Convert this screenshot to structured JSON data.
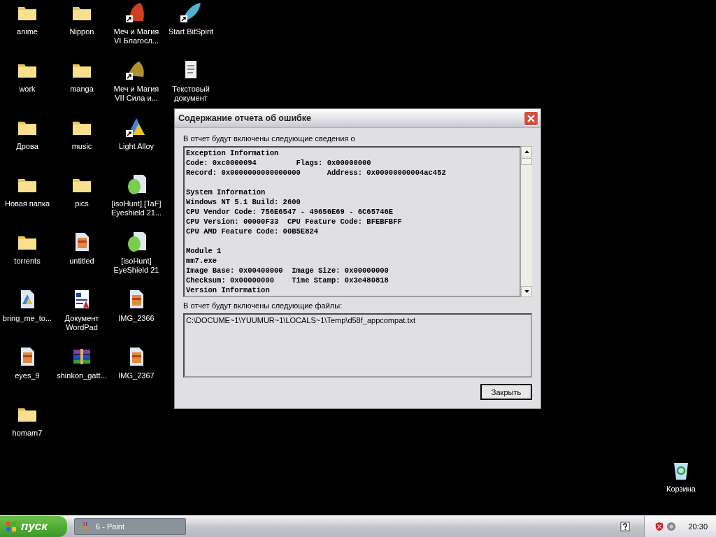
{
  "desktop_columns": [
    [
      {
        "label": "anime",
        "kind": "folder",
        "shortcut": false
      },
      {
        "label": "work",
        "kind": "folder",
        "shortcut": false
      },
      {
        "label": "Дрова",
        "kind": "folder",
        "shortcut": false
      },
      {
        "label": "Новая папка",
        "kind": "folder",
        "shortcut": false
      },
      {
        "label": "torrents",
        "kind": "folder",
        "shortcut": false
      },
      {
        "label": "bring_me_to...",
        "kind": "media",
        "shortcut": false
      },
      {
        "label": "eyes_9",
        "kind": "image",
        "shortcut": false
      },
      {
        "label": "homam7",
        "kind": "folder",
        "shortcut": false
      }
    ],
    [
      {
        "label": "Nippon",
        "kind": "folder",
        "shortcut": false
      },
      {
        "label": "manga",
        "kind": "folder",
        "shortcut": false
      },
      {
        "label": "music",
        "kind": "folder",
        "shortcut": false
      },
      {
        "label": "pics",
        "kind": "folder",
        "shortcut": false
      },
      {
        "label": "untitled",
        "kind": "image",
        "shortcut": false
      },
      {
        "label": "Документ WordPad",
        "kind": "wordpad",
        "shortcut": false
      },
      {
        "label": "shinkon_gatt...",
        "kind": "archive",
        "shortcut": false
      }
    ],
    [
      {
        "label": "Меч и Магия VI Благосл...",
        "kind": "dragon",
        "shortcut": true
      },
      {
        "label": "Меч и Магия VII Сила и...",
        "kind": "griffin",
        "shortcut": true
      },
      {
        "label": "Light Alloy",
        "kind": "player",
        "shortcut": true
      },
      {
        "label": "[isoHunt] [TaF] Eyeshield 21...",
        "kind": "torrent",
        "shortcut": false
      },
      {
        "label": "[isoHunt] EyeShield 21",
        "kind": "torrent",
        "shortcut": false
      },
      {
        "label": "IMG_2366",
        "kind": "image",
        "shortcut": false
      },
      {
        "label": "IMG_2367",
        "kind": "image",
        "shortcut": false
      }
    ],
    [
      {
        "label": "Start BitSpirit",
        "kind": "feather",
        "shortcut": true
      },
      {
        "label": "Текстовый документ",
        "kind": "text",
        "shortcut": false
      }
    ]
  ],
  "recycle_bin": {
    "label": "Корзина"
  },
  "dialog": {
    "title": "Содержание отчета об ошибке",
    "details_label": "В отчет будут включены следующие сведения о",
    "details": [
      [
        "Exception Information",
        "Code: 0xc0000094         Flags: 0x00000000",
        "Record: 0x0000000000000000      Address: 0x00000000004ac452"
      ],
      [
        "System Information",
        "Windows NT 5.1 Build: 2600",
        "CPU Vendor Code: 756E6547 - 49656E69 - 6C65746E",
        "CPU Version: 00000F33  CPU Feature Code: BFEBFBFF",
        "CPU AMD Feature Code: 00B5E824"
      ],
      [
        "Module 1",
        "mm7.exe",
        "Image Base: 0x00400000  Image Size: 0x00000000",
        "Checksum: 0x00000000    Time Stamp: 0x3e480818",
        "Version Information"
      ]
    ],
    "files_label": "В отчет будут включены следующие файлы:",
    "files": [
      "C:\\DOCUME~1\\YUUMUR~1\\LOCALS~1\\Temp\\d58f_appcompat.txt"
    ],
    "close_button": "Закрыть"
  },
  "taskbar": {
    "start": "пуск",
    "tasks": [
      {
        "label": "6 - Paint"
      }
    ],
    "clock": "20:30"
  }
}
